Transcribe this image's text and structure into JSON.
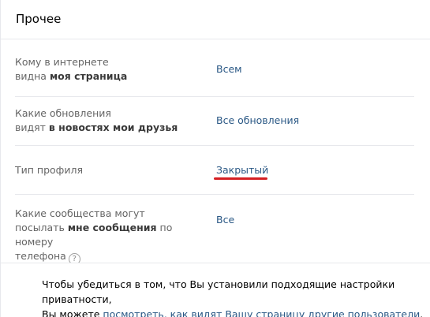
{
  "section": {
    "title": "Прочее"
  },
  "rows": [
    {
      "label_line1": "Кому в интернете",
      "label_prefix": "видна ",
      "label_bold": "моя страница",
      "value": "Всем"
    },
    {
      "label_line1": "Какие обновления",
      "label_prefix": "видят ",
      "label_bold": "в новостях мои друзья",
      "value": "Все обновления"
    },
    {
      "label": "Тип профиля",
      "value": "Закрытый"
    },
    {
      "label_line1": "Какие сообщества могут",
      "label_prefix": "посылать ",
      "label_bold": "мне сообщения",
      "label_suffix": " по номеру",
      "label_line3": "телефона",
      "help": "?",
      "value": "Все"
    }
  ],
  "footer": {
    "text_before": "Чтобы убедиться в том, что Вы установили подходящие настройки приватности,",
    "text_line2_prefix": "Вы можете ",
    "link_text": "посмотреть, как видят Вашу страницу другие пользователи",
    "text_line2_suffix": "."
  },
  "colors": {
    "link": "#2a5885",
    "highlight_underline": "#d51f23",
    "divider": "#e7e8ec"
  }
}
